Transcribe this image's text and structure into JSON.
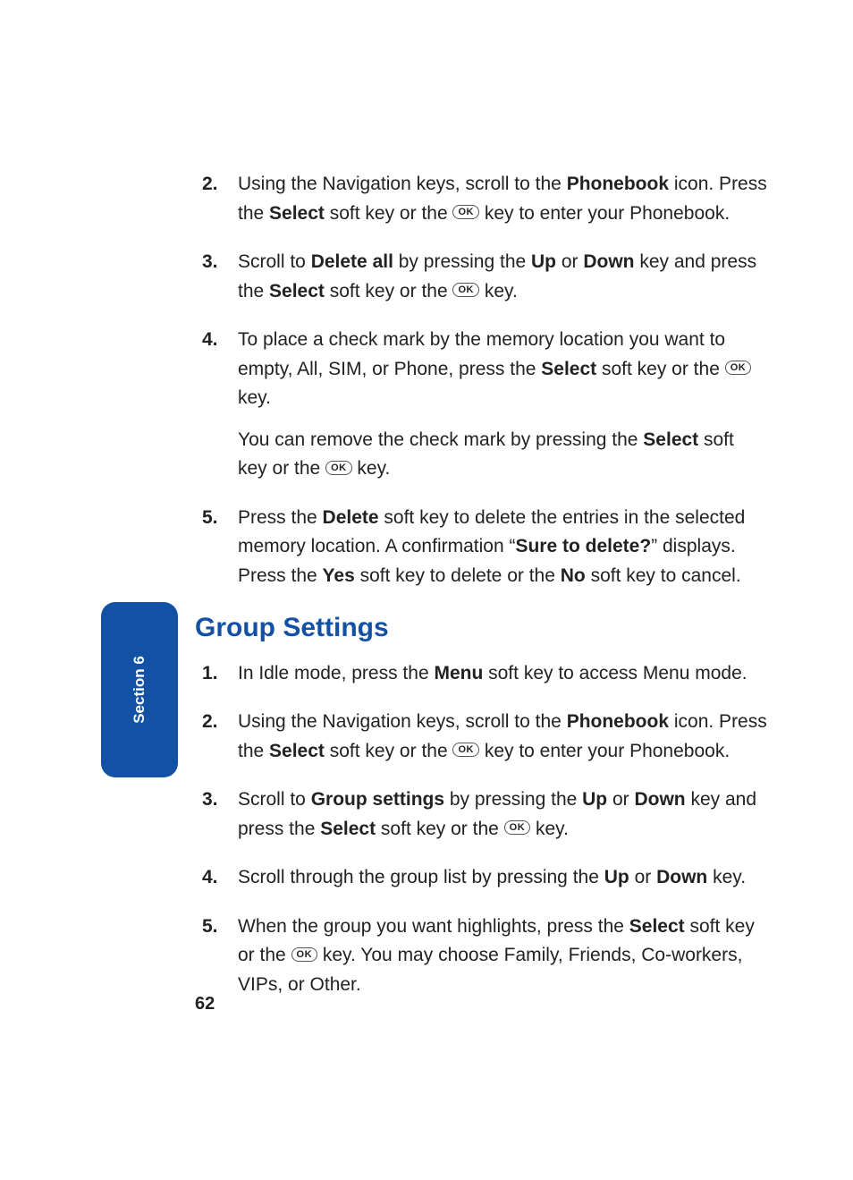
{
  "sideTab": {
    "label": "Section 6"
  },
  "pageNumber": "62",
  "okLabel": "OK",
  "topList": [
    {
      "num": "2.",
      "segments": [
        {
          "t": "Using the Navigation keys, scroll to the "
        },
        {
          "t": "Phonebook",
          "b": true
        },
        {
          "t": " icon. Press the "
        },
        {
          "t": "Select",
          "b": true
        },
        {
          "t": " soft key or the "
        },
        {
          "ok": true
        },
        {
          "t": " key to enter your Phonebook."
        }
      ]
    },
    {
      "num": "3.",
      "segments": [
        {
          "t": "Scroll to "
        },
        {
          "t": "Delete all",
          "b": true
        },
        {
          "t": " by pressing the "
        },
        {
          "t": "Up",
          "b": true
        },
        {
          "t": " or "
        },
        {
          "t": "Down",
          "b": true
        },
        {
          "t": " key and press the "
        },
        {
          "t": "Select",
          "b": true
        },
        {
          "t": " soft key or the "
        },
        {
          "ok": true
        },
        {
          "t": " key."
        }
      ]
    },
    {
      "num": "4.",
      "segments": [
        {
          "t": "To place a check mark by the memory location you want to empty, All, SIM, or Phone, press the "
        },
        {
          "t": "Select",
          "b": true
        },
        {
          "t": " soft key or the "
        },
        {
          "ok": true
        },
        {
          "t": " key."
        }
      ],
      "extra": [
        {
          "t": "You can remove the check mark by pressing the "
        },
        {
          "t": "Select",
          "b": true
        },
        {
          "t": " soft key or the "
        },
        {
          "ok": true
        },
        {
          "t": " key."
        }
      ]
    },
    {
      "num": "5.",
      "segments": [
        {
          "t": "Press the "
        },
        {
          "t": "Delete",
          "b": true
        },
        {
          "t": " soft key to delete the entries in the selected memory location. A confirmation “"
        },
        {
          "t": "Sure to delete?",
          "b": true
        },
        {
          "t": "” displays. Press the "
        },
        {
          "t": "Yes",
          "b": true
        },
        {
          "t": " soft key to delete or the "
        },
        {
          "t": "No",
          "b": true
        },
        {
          "t": " soft key to cancel."
        }
      ]
    }
  ],
  "heading": "Group Settings",
  "bottomList": [
    {
      "num": "1.",
      "segments": [
        {
          "t": "In Idle mode, press the "
        },
        {
          "t": "Menu",
          "b": true
        },
        {
          "t": " soft key to access Menu mode."
        }
      ]
    },
    {
      "num": "2.",
      "segments": [
        {
          "t": "Using the Navigation keys, scroll to the "
        },
        {
          "t": "Phonebook",
          "b": true
        },
        {
          "t": " icon. Press the "
        },
        {
          "t": "Select",
          "b": true
        },
        {
          "t": " soft key or the "
        },
        {
          "ok": true
        },
        {
          "t": " key to enter your Phonebook."
        }
      ]
    },
    {
      "num": "3.",
      "segments": [
        {
          "t": "Scroll to "
        },
        {
          "t": "Group settings",
          "b": true
        },
        {
          "t": " by pressing the "
        },
        {
          "t": "Up",
          "b": true
        },
        {
          "t": " or "
        },
        {
          "t": "Down",
          "b": true
        },
        {
          "t": " key and press the "
        },
        {
          "t": "Select",
          "b": true
        },
        {
          "t": " soft key or the "
        },
        {
          "ok": true
        },
        {
          "t": " key."
        }
      ]
    },
    {
      "num": "4.",
      "segments": [
        {
          "t": "Scroll through the group list by pressing the "
        },
        {
          "t": "Up",
          "b": true
        },
        {
          "t": " or "
        },
        {
          "t": "Down",
          "b": true
        },
        {
          "t": " key."
        }
      ]
    },
    {
      "num": "5.",
      "segments": [
        {
          "t": "When the group you want highlights, press the "
        },
        {
          "t": "Select",
          "b": true
        },
        {
          "t": " soft key or the "
        },
        {
          "ok": true
        },
        {
          "t": " key. You may choose Family, Friends, Co-workers, VIPs, or Other."
        }
      ]
    }
  ]
}
